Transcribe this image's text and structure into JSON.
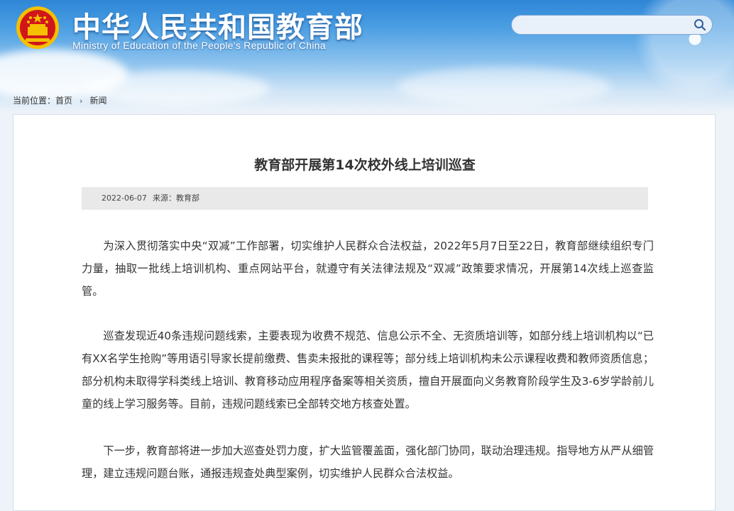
{
  "header": {
    "title": "中华人民共和国教育部",
    "subtitle": "Ministry of Education of the People's Republic of China",
    "emblem_icon": "national-emblem-icon"
  },
  "search": {
    "placeholder": "",
    "icon": "search-icon"
  },
  "breadcrumb": {
    "prefix": "当前位置：",
    "home": "首页",
    "separator": "›",
    "current": "新闻"
  },
  "article": {
    "title": "教育部开展第14次校外线上培训巡查",
    "date": "2022-06-07",
    "source": "来源：教育部",
    "paragraphs": [
      "为深入贯彻落实中央“双减”工作部署，切实维护人民群众合法权益，2022年5月7日至22日，教育部继续组织专门力量，抽取一批线上培训机构、重点网站平台，就遵守有关法律法规及“双减”政策要求情况，开展第14次线上巡查监管。",
      "巡查发现近40条违规问题线索，主要表现为收费不规范、信息公示不全、无资质培训等，如部分线上培训机构以“已有XX名学生抢购”等用语引导家长提前缴费、售卖未报批的课程等；部分线上培训机构未公示课程收费和教师资质信息；部分机构未取得学科类线上培训、教育移动应用程序备案等相关资质，擅自开展面向义务教育阶段学生及3-6岁学龄前儿童的线上学习服务等。目前，违规问题线索已全部转交地方核查处置。",
      "下一步，教育部将进一步加大巡查处罚力度，扩大监管覆盖面，强化部门协同，联动治理违规。指导地方从严从细管理，建立违规问题台账，通报违规查处典型案例，切实维护人民群众合法权益。"
    ]
  },
  "colors": {
    "header_blue": "#2e86d6",
    "text": "#333333",
    "meta_bg": "#e9e9e9",
    "emblem_red": "#d0161b",
    "emblem_gold": "#f5c000"
  }
}
